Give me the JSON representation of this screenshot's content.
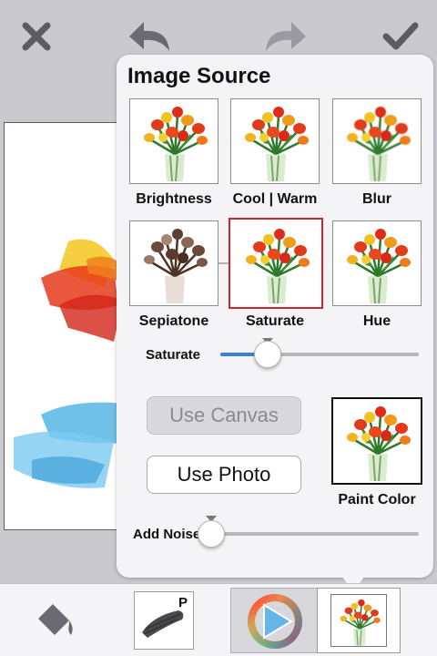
{
  "top_toolbar": {
    "cancel_icon": "close-x-icon",
    "undo_icon": "undo-arrow-icon",
    "redo_icon": "redo-arrow-icon",
    "confirm_icon": "checkmark-icon"
  },
  "popover": {
    "title": "Image Source",
    "thumbnails": [
      {
        "label": "Brightness",
        "style": "color"
      },
      {
        "label": "Cool | Warm",
        "style": "color"
      },
      {
        "label": "Blur",
        "style": "color"
      },
      {
        "label": "Sepiatone",
        "style": "sepia"
      },
      {
        "label": "Saturate",
        "style": "color",
        "selected": true
      },
      {
        "label": "Hue",
        "style": "color"
      }
    ],
    "saturate_slider": {
      "label": "Saturate",
      "value": 0.24
    },
    "use_canvas_label": "Use Canvas",
    "use_photo_label": "Use Photo",
    "paint_color_label": "Paint Color",
    "noise_slider": {
      "label": "Add Noise",
      "value": 0.0
    }
  },
  "bottom_toolbar": {
    "bucket_icon": "paint-bucket-icon",
    "brush_badge": "P",
    "color_wheel_icon": "color-wheel-icon",
    "photo_icon": "photo-thumbnail-icon"
  },
  "colors": {
    "accent_blue": "#3c7fd6",
    "selected_red": "#d0262b",
    "popover_bg": "#f4f4f6",
    "background": "#c9c9ce"
  }
}
